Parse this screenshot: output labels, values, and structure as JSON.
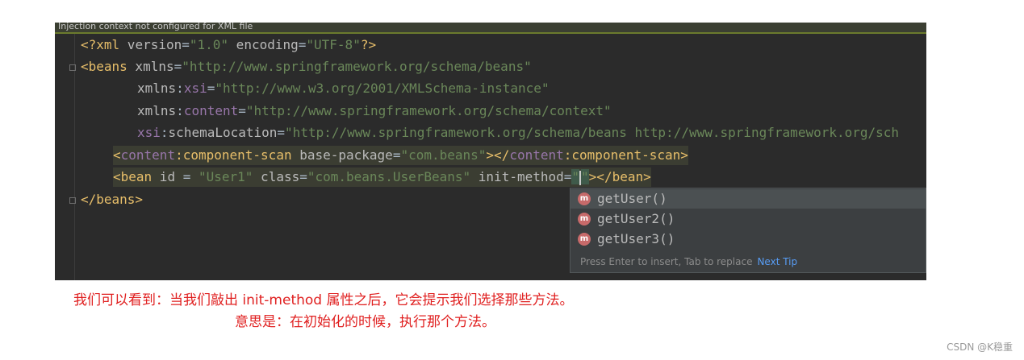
{
  "editor": {
    "banner": "Injection context not configured for XML file",
    "lines": {
      "l1": {
        "pi_open": "<?",
        "name": "xml",
        "a1": " version",
        "eq1": "=",
        "v1": "\"1.0\"",
        "a2": " encoding",
        "eq2": "=",
        "v2": "\"UTF-8\"",
        "pi_close": "?>"
      },
      "l2": {
        "open": "<beans",
        "attr": " xmlns",
        "eq": "=",
        "val": "\"http://www.springframework.org/schema/beans\""
      },
      "l3": {
        "attr": "xmlns",
        "colon": ":",
        "ns": "xsi",
        "eq": "=",
        "val": "\"http://www.w3.org/2001/XMLSchema-instance\""
      },
      "l4": {
        "attr": "xmlns",
        "colon": ":",
        "ns": "content",
        "eq": "=",
        "val": "\"http://www.springframework.org/schema/context\""
      },
      "l5": {
        "ns": "xsi",
        "colon": ":",
        "attr": "schemaLocation",
        "eq": "=",
        "val": "\"http://www.springframework.org/schema/beans http://www.springframework.org/sch"
      },
      "l6": {
        "lt": "<",
        "ns": "content",
        "colon": ":",
        "name": "component-scan",
        "attr": " base-package",
        "eq": "=",
        "val": "\"com.beans\"",
        "mid": "></",
        "ns2": "content",
        "colon2": ":",
        "name2": "component-scan",
        "gt": ">"
      },
      "l7": {
        "open": "<bean",
        "a1": " id",
        "eq1": " = ",
        "v1": "\"User1\"",
        "a2": " class",
        "eq2": "=",
        "v2": "\"com.beans.UserBeans\"",
        "a3": " init-method",
        "eq3": "=",
        "q1": "\"",
        "q2": "\"",
        "close": "></bean>"
      },
      "l8": {
        "close": "</beans>"
      }
    }
  },
  "completion": {
    "items": [
      {
        "icon": "m",
        "label": "getUser()"
      },
      {
        "icon": "m",
        "label": "getUser2()"
      },
      {
        "icon": "m",
        "label": "getUser3()"
      }
    ],
    "hint": "Press Enter to insert, Tab to replace",
    "next_tip": "Next Tip"
  },
  "caption": {
    "line1": "我们可以看到：当我们敲出 init-method 属性之后，它会提示我们选择那些方法。",
    "line2": "意思是：在初始化的时候，执行那个方法。"
  },
  "watermark": "CSDN @K稳重",
  "colors": {
    "tag": "#e8bf6a",
    "string": "#6a8759",
    "namespace": "#9876aa",
    "caption": "#e02020"
  }
}
